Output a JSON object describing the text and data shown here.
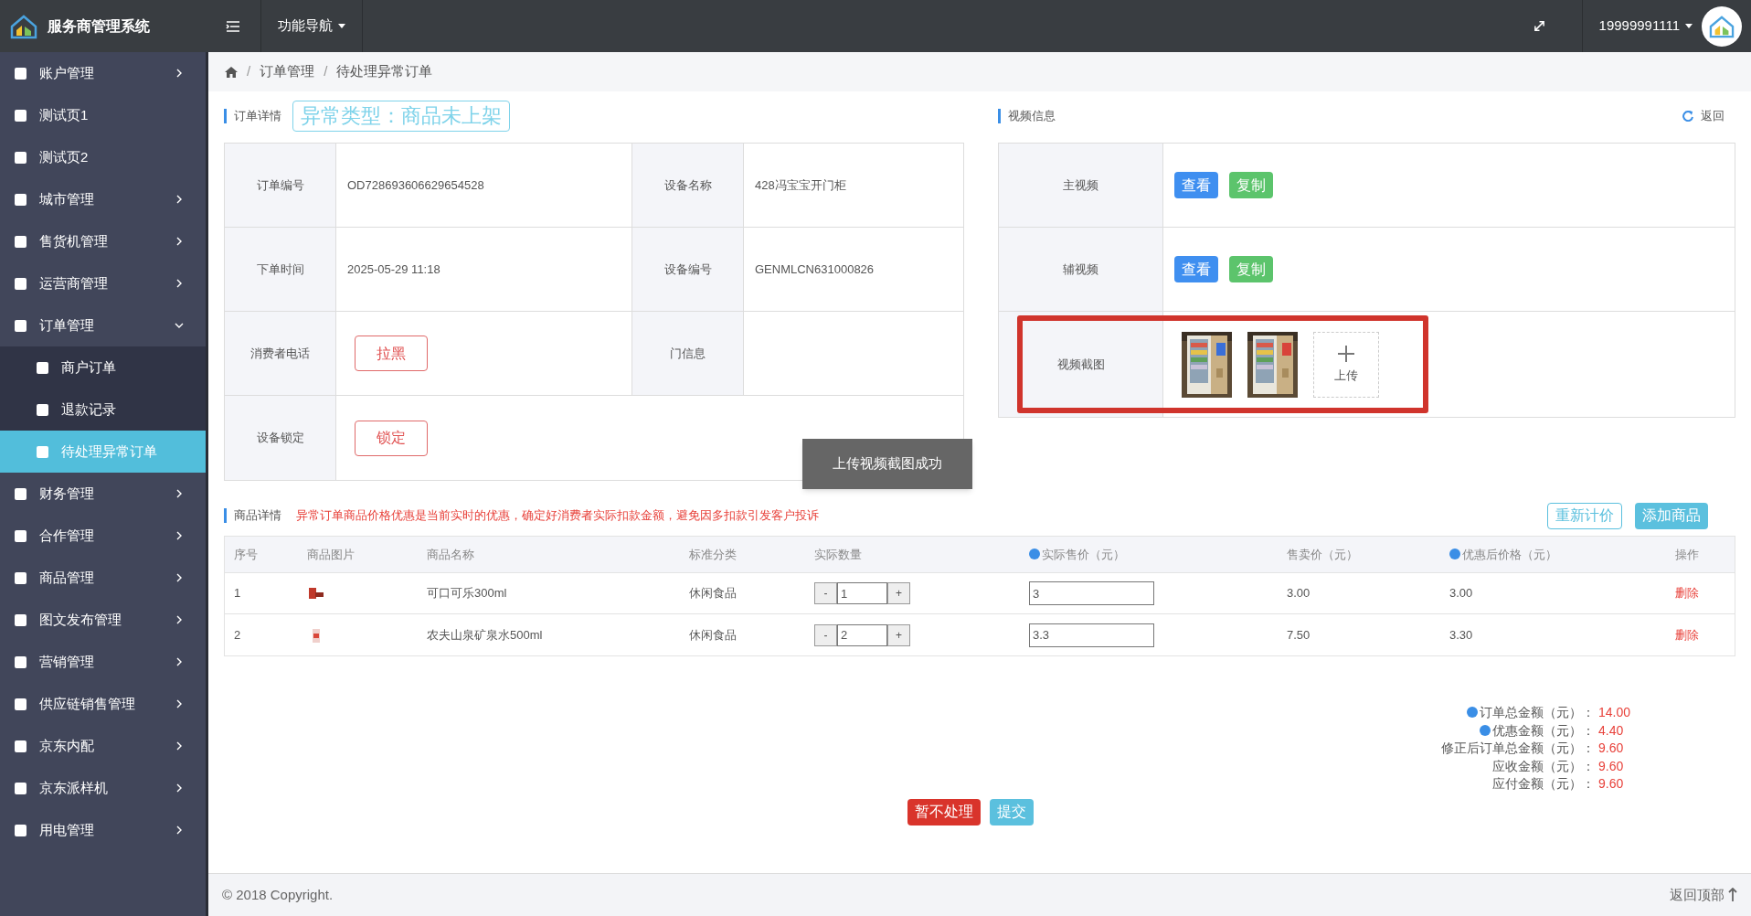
{
  "header": {
    "title": "服务商管理系统",
    "nav_menu": "功能导航",
    "user": "19999991111"
  },
  "sidebar": {
    "items": [
      {
        "label": "账户管理",
        "expandable": true,
        "expanded": false
      },
      {
        "label": "测试页1",
        "expandable": false
      },
      {
        "label": "测试页2",
        "expandable": false
      },
      {
        "label": "城市管理",
        "expandable": true,
        "expanded": false
      },
      {
        "label": "售货机管理",
        "expandable": true,
        "expanded": false
      },
      {
        "label": "运营商管理",
        "expandable": true,
        "expanded": false
      },
      {
        "label": "订单管理",
        "expandable": true,
        "expanded": true,
        "children": [
          {
            "label": "商户订单",
            "selected": false
          },
          {
            "label": "退款记录",
            "selected": false
          },
          {
            "label": "待处理异常订单",
            "selected": true
          }
        ]
      },
      {
        "label": "财务管理",
        "expandable": true,
        "expanded": false
      },
      {
        "label": "合作管理",
        "expandable": true,
        "expanded": false
      },
      {
        "label": "商品管理",
        "expandable": true,
        "expanded": false
      },
      {
        "label": "图文发布管理",
        "expandable": true,
        "expanded": false
      },
      {
        "label": "营销管理",
        "expandable": true,
        "expanded": false
      },
      {
        "label": "供应链销售管理",
        "expandable": true,
        "expanded": false
      },
      {
        "label": "京东内配",
        "expandable": true,
        "expanded": false
      },
      {
        "label": "京东派样机",
        "expandable": true,
        "expanded": false
      },
      {
        "label": "用电管理",
        "expandable": true,
        "expanded": false
      }
    ]
  },
  "breadcrumb": {
    "separator": "/",
    "items": [
      "订单管理",
      "待处理异常订单"
    ]
  },
  "order_detail": {
    "title": "订单详情",
    "exception_type": "异常类型：商品未上架",
    "rows": [
      [
        {
          "label": "订单编号",
          "value": "OD728693606629654528"
        },
        {
          "label": "设备名称",
          "value": "428冯宝宝开门柜"
        }
      ],
      [
        {
          "label": "下单时间",
          "value": "2025-05-29 11:18"
        },
        {
          "label": "设备编号",
          "value": "GENMLCN631000826"
        }
      ],
      [
        {
          "label": "消费者电话",
          "button": "拉黑"
        },
        {
          "label": "门信息"
        }
      ],
      [
        {
          "label": "设备锁定",
          "button": "锁定"
        }
      ]
    ]
  },
  "toast": "上传视频截图成功",
  "video_info": {
    "title": "视频信息",
    "back": "返回",
    "rows": [
      {
        "kind": "links",
        "label": "主视频",
        "view": "查看",
        "copy": "复制"
      },
      {
        "kind": "links",
        "label": "辅视频",
        "view": "查看",
        "copy": "复制"
      },
      {
        "kind": "screenshots",
        "label": "视频截图",
        "upload": "上传",
        "highlighted": true
      }
    ]
  },
  "goods": {
    "title": "商品详情",
    "notice": "异常订单商品价格优惠是当前实时的优惠，确定好消费者实际扣款金额，避免因多扣款引发客户投诉",
    "reprice": "重新计价",
    "add": "添加商品",
    "columns": [
      {
        "label": "序号",
        "help": false
      },
      {
        "label": "商品图片",
        "help": false
      },
      {
        "label": "商品名称",
        "help": false
      },
      {
        "label": "标准分类",
        "help": false
      },
      {
        "label": "实际数量",
        "help": false
      },
      {
        "label": "实际售价（元）",
        "help": true
      },
      {
        "label": "售卖价（元）",
        "help": false
      },
      {
        "label": "优惠后价格（元）",
        "help": true
      },
      {
        "label": "操作",
        "help": false
      }
    ],
    "rows": [
      {
        "index": "1",
        "name": "可口可乐300ml",
        "category": "休闲食品",
        "quantity": "1",
        "actual_price": "3",
        "sale_price": "3.00",
        "discounted": "3.00",
        "action": "删除",
        "minus": "-",
        "plus": "+"
      },
      {
        "index": "2",
        "name": "农夫山泉矿泉水500ml",
        "category": "休闲食品",
        "quantity": "2",
        "actual_price": "3.3",
        "sale_price": "7.50",
        "discounted": "3.30",
        "action": "删除",
        "minus": "-",
        "plus": "+"
      }
    ]
  },
  "totals": [
    {
      "label": "订单总金额（元）：",
      "value": "14.00",
      "help": true
    },
    {
      "label": "优惠金额（元）：",
      "value": "4.40",
      "help": true
    },
    {
      "label": "修正后订单总金额（元）：",
      "value": "9.60",
      "help": false
    },
    {
      "label": "应收金额（元）：",
      "value": "9.60",
      "help": false
    },
    {
      "label": "应付金额（元）：",
      "value": "9.60",
      "help": false
    }
  ],
  "actions": {
    "hold": "暂不处理",
    "submit": "提交"
  },
  "footer": {
    "copyright": "© 2018 Copyright.",
    "back_top": "返回顶部"
  }
}
